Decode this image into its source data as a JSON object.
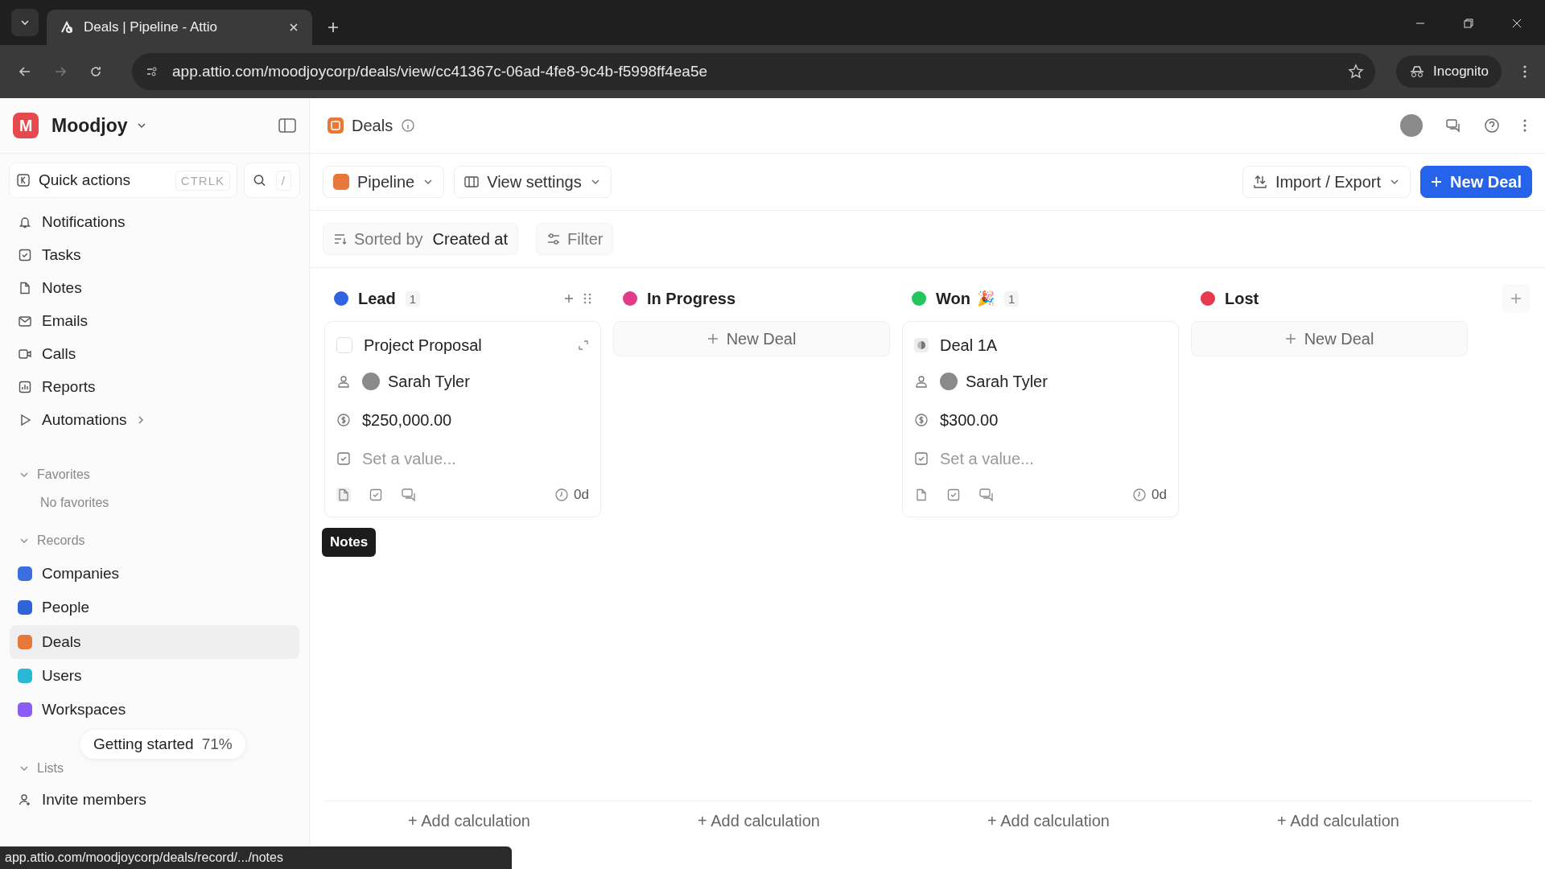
{
  "browser": {
    "tab_title": "Deals | Pipeline - Attio",
    "url": "app.attio.com/moodjoycorp/deals/view/cc41367c-06ad-4fe8-9c4b-f5998ff4ea5e",
    "profile": "Incognito"
  },
  "workspace": {
    "initial": "M",
    "name": "Moodjoy"
  },
  "quick_actions": {
    "label": "Quick actions",
    "shortcut": "CTRLK",
    "search_shortcut": "/"
  },
  "nav": [
    {
      "label": "Notifications",
      "kind": "bell",
      "has_arrow": false
    },
    {
      "label": "Tasks",
      "kind": "check",
      "has_arrow": false
    },
    {
      "label": "Notes",
      "kind": "doc",
      "has_arrow": false
    },
    {
      "label": "Emails",
      "kind": "mail",
      "has_arrow": false
    },
    {
      "label": "Calls",
      "kind": "video",
      "has_arrow": false
    },
    {
      "label": "Reports",
      "kind": "chart",
      "has_arrow": false
    },
    {
      "label": "Automations",
      "kind": "play",
      "has_arrow": true
    }
  ],
  "favorites": {
    "title": "Favorites",
    "empty": "No favorites"
  },
  "records": {
    "title": "Records",
    "items": [
      {
        "label": "Companies",
        "color": "#3b6fe0",
        "selected": false
      },
      {
        "label": "People",
        "color": "#2f63d8",
        "selected": false
      },
      {
        "label": "Deals",
        "color": "#e8783a",
        "selected": true
      },
      {
        "label": "Users",
        "color": "#27b8d6",
        "selected": false
      },
      {
        "label": "Workspaces",
        "color": "#8b5cf6",
        "selected": false
      }
    ]
  },
  "lists": {
    "title": "Lists"
  },
  "invite": "Invite members",
  "getting_started": {
    "label": "Getting started",
    "percent": "71%"
  },
  "page": {
    "title": "Deals"
  },
  "toolbar": {
    "view": "Pipeline",
    "settings": "View settings",
    "import_export": "Import / Export",
    "new_deal": "New Deal"
  },
  "sort": {
    "prefix": "Sorted by",
    "field": "Created at"
  },
  "filter": "Filter",
  "columns": [
    {
      "name": "Lead",
      "color": "#2f63e0",
      "count": "1",
      "cards": [
        {
          "title": "Project Proposal",
          "kind": "checkbox",
          "checked": false,
          "owner": "Sarah Tyler",
          "value": "$250,000.00",
          "placeholder": "Set a value...",
          "age": "0d",
          "hovered": true
        }
      ],
      "calc": "+ Add calculation"
    },
    {
      "name": "In Progress",
      "color": "#e23b8a",
      "add": "New Deal",
      "calc": "+ Add calculation"
    },
    {
      "name": "Won",
      "color": "#22c55e",
      "count": "1",
      "emoji": "🎉",
      "cards": [
        {
          "title": "Deal 1A",
          "kind": "record",
          "owner": "Sarah Tyler",
          "value": "$300.00",
          "placeholder": "Set a value...",
          "age": "0d",
          "hovered": false
        }
      ],
      "calc": "+ Add calculation"
    },
    {
      "name": "Lost",
      "color": "#e5394f",
      "add": "New Deal",
      "calc": "+ Add calculation"
    }
  ],
  "tooltip": "Notes",
  "status_url": "app.attio.com/moodjoycorp/deals/record/.../notes"
}
